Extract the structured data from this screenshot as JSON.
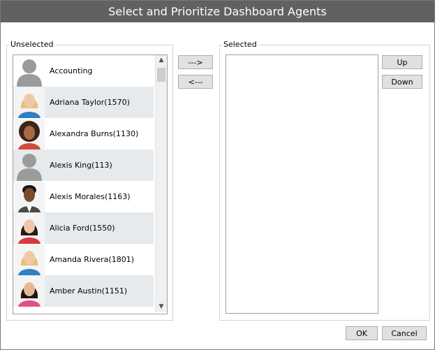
{
  "window": {
    "title": "Select and Prioritize Dashboard Agents"
  },
  "unselected": {
    "label": "Unselected",
    "items": [
      {
        "name": "Accounting",
        "avatar": "placeholder"
      },
      {
        "name": "Adriana Taylor(1570)",
        "avatar": "photo-blonde"
      },
      {
        "name": "Alexandra Burns(1130)",
        "avatar": "photo-curly-dark"
      },
      {
        "name": "Alexis King(113)",
        "avatar": "placeholder"
      },
      {
        "name": "Alexis Morales(1163)",
        "avatar": "photo-short-dark"
      },
      {
        "name": "Alicia Ford(1550)",
        "avatar": "photo-dark-red"
      },
      {
        "name": "Amanda Rivera(1801)",
        "avatar": "photo-blonde"
      },
      {
        "name": "Amber Austin(1151)",
        "avatar": "photo-dark-pink"
      }
    ]
  },
  "selected": {
    "label": "Selected",
    "items": []
  },
  "transfer": {
    "add_label": "--->",
    "remove_label": "<---"
  },
  "order": {
    "up_label": "Up",
    "down_label": "Down"
  },
  "footer": {
    "ok_label": "OK",
    "cancel_label": "Cancel"
  },
  "colors": {
    "titlebar": "#616161",
    "alt_row": "#e6eaed",
    "button": "#e1e1e1"
  }
}
